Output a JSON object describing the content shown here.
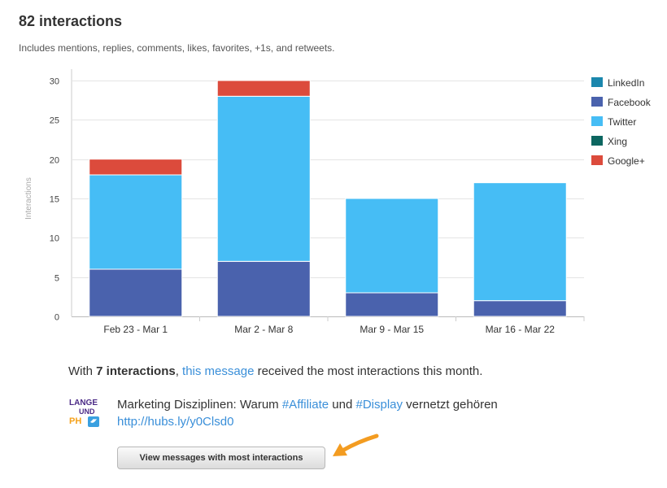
{
  "header": {
    "title": "82 interactions",
    "subtitle": "Includes mentions, replies, comments, likes, favorites, +1s, and retweets."
  },
  "chart_data": {
    "type": "bar",
    "stacked": true,
    "ylabel": "Interactions",
    "ylim": [
      0,
      30
    ],
    "yticks": [
      0,
      5,
      10,
      15,
      20,
      25,
      30
    ],
    "grid": true,
    "legend_position": "right",
    "categories": [
      "Feb 23 - Mar 1",
      "Mar 2 - Mar 8",
      "Mar 9 - Mar 15",
      "Mar 16 - Mar 22"
    ],
    "series": [
      {
        "name": "LinkedIn",
        "color": "#1b87ad",
        "values": [
          0,
          0,
          0,
          0
        ]
      },
      {
        "name": "Facebook",
        "color": "#4a62ad",
        "values": [
          6,
          7,
          3,
          2
        ]
      },
      {
        "name": "Twitter",
        "color": "#46bdf5",
        "values": [
          12,
          21,
          12,
          15
        ]
      },
      {
        "name": "Xing",
        "color": "#0c6660",
        "values": [
          0,
          0,
          0,
          0
        ]
      },
      {
        "name": "Google+",
        "color": "#dc4b3c",
        "values": [
          2,
          2,
          0,
          0
        ]
      }
    ]
  },
  "summary": {
    "prefix": "With ",
    "count_text": "7 interactions",
    "comma": ", ",
    "link_text": "this message",
    "suffix": " received the most interactions this month."
  },
  "message": {
    "text_1": "Marketing Disziplinen: Warum ",
    "hashtag_1": "#Affiliate",
    "text_2": " und ",
    "hashtag_2": "#Display",
    "text_3": " vernetzt gehören",
    "url": "http://hubs.ly/y0Clsd0",
    "avatar_lines": [
      "LANGE",
      "UND",
      "PH"
    ],
    "avatar_colors": {
      "purple": "#4b2a86",
      "orange": "#f5a21b",
      "blue": "#3aa0e0"
    }
  },
  "button": {
    "label": "View messages with most interactions"
  },
  "arrow": {
    "color": "#f39c21"
  }
}
